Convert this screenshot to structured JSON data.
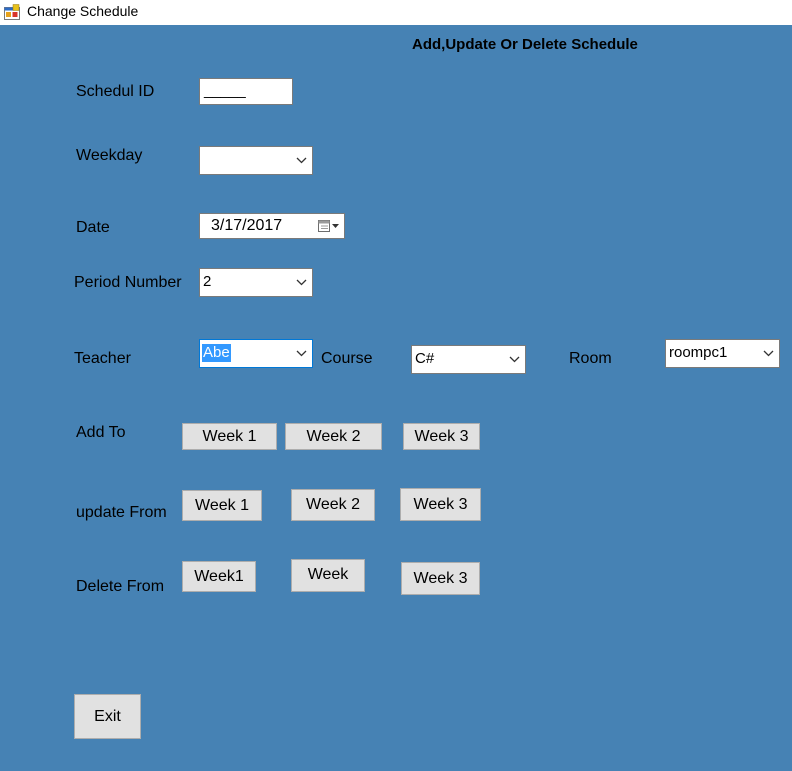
{
  "window": {
    "title": "Change Schedule",
    "app_icon": "windows-form-icon"
  },
  "heading": "Add,Update Or Delete Schedule",
  "schedule_id": {
    "label": "Schedul ID",
    "value": "_____"
  },
  "weekday": {
    "label": "Weekday",
    "value": ""
  },
  "date": {
    "label": "Date",
    "value": "3/17/2017",
    "icon": "calendar-dropdown-icon"
  },
  "period": {
    "label": "Period Number",
    "value": "2"
  },
  "teacher": {
    "label": "Teacher",
    "value": "Abe"
  },
  "course": {
    "label": "Course",
    "value": "C#"
  },
  "room": {
    "label": "Room",
    "value": "roompc1"
  },
  "add_to": {
    "label": "Add To",
    "buttons": [
      "Week 1",
      "Week 2",
      "Week 3"
    ]
  },
  "update_from": {
    "label": "update From",
    "buttons": [
      "Week 1",
      "Week 2",
      "Week 3"
    ]
  },
  "delete_from": {
    "label": "Delete From",
    "buttons": [
      "Week1",
      "Week",
      "Week 3"
    ]
  },
  "exit_label": "Exit",
  "colors": {
    "form_background": "#4682b4",
    "button_face": "#e1e1e1",
    "selection": "#3399ff"
  }
}
